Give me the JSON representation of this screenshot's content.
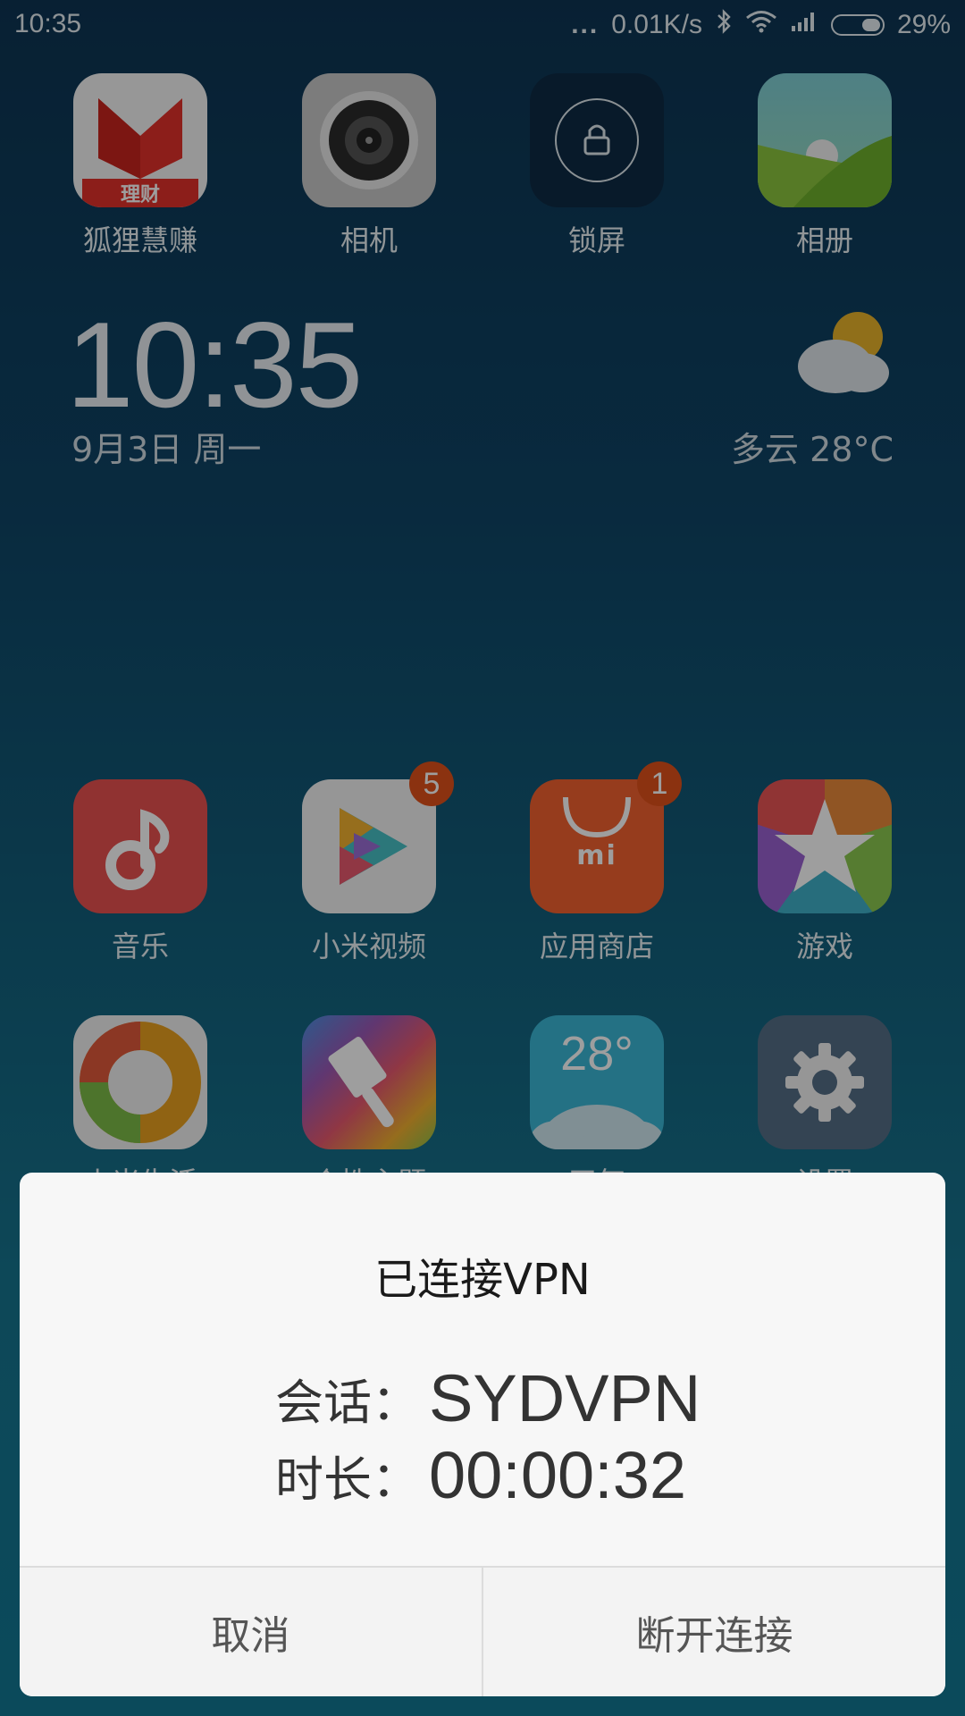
{
  "status_bar": {
    "time": "10:35",
    "dots": "...",
    "speed": "0.01K/s",
    "battery": "29%",
    "battery_level": 0.29
  },
  "apps_top": [
    {
      "label": "狐狸慧赚",
      "icon": "foxlicai-icon",
      "sublabel": "理财"
    },
    {
      "label": "相机",
      "icon": "camera-icon"
    },
    {
      "label": "锁屏",
      "icon": "lock-icon"
    },
    {
      "label": "相册",
      "icon": "gallery-icon"
    }
  ],
  "widget": {
    "time": "10:35",
    "date": "9月3日 周一",
    "weather": "多云  28°C",
    "weather_icon": "partly-cloudy-icon"
  },
  "apps_row2": [
    {
      "label": "音乐",
      "icon": "music-icon"
    },
    {
      "label": "小米视频",
      "icon": "video-icon",
      "badge": "5"
    },
    {
      "label": "应用商店",
      "icon": "app-store-icon",
      "badge": "1",
      "logo": "mi"
    },
    {
      "label": "游戏",
      "icon": "games-icon"
    }
  ],
  "apps_row3": [
    {
      "label": "小米生活",
      "icon": "mi-life-icon"
    },
    {
      "label": "个性主题",
      "icon": "themes-icon"
    },
    {
      "label": "天气",
      "icon": "weather-icon",
      "temp": "28°"
    },
    {
      "label": "设置",
      "icon": "settings-icon"
    }
  ],
  "dialog": {
    "title": "已连接VPN",
    "session_label": "会话：",
    "session_value": "SYDVPN",
    "duration_label": "时长：",
    "duration_value": "00:00:32",
    "cancel": "取消",
    "disconnect": "断开连接"
  },
  "colors": {
    "badge": "#e0521b",
    "dialog_bg": "#f7f7f7"
  }
}
